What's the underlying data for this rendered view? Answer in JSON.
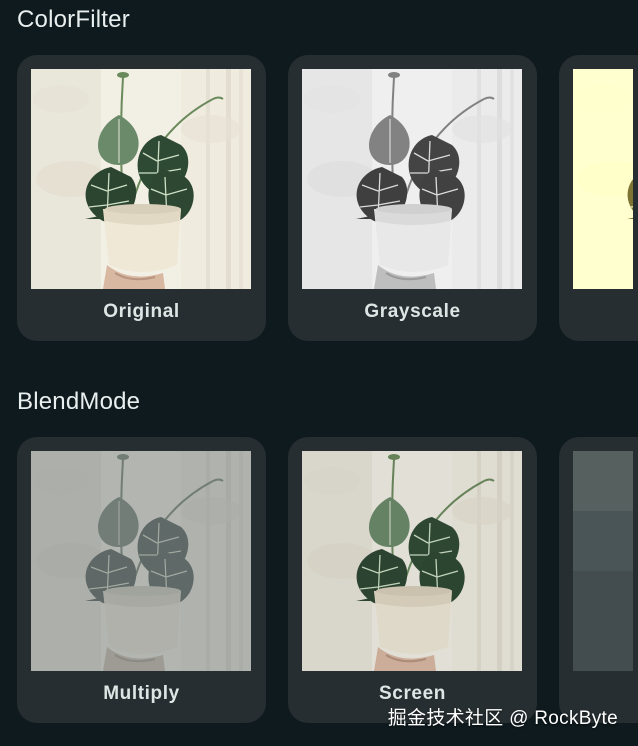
{
  "sections": [
    {
      "title": "ColorFilter",
      "cards": [
        {
          "label": "Original",
          "filter": "original"
        },
        {
          "label": "Grayscale",
          "filter": "grayscale"
        },
        {
          "label": "",
          "filter": "sepia"
        }
      ]
    },
    {
      "title": "BlendMode",
      "cards": [
        {
          "label": "Multiply",
          "filter": "multiply"
        },
        {
          "label": "Screen",
          "filter": "screen"
        },
        {
          "label": "",
          "filter": "dim"
        }
      ]
    }
  ],
  "watermark": "掘金技术社区 @ RockByte",
  "colors": {
    "background": "#0e1a1e",
    "card": "#262e31",
    "text": "#e7ecec"
  }
}
